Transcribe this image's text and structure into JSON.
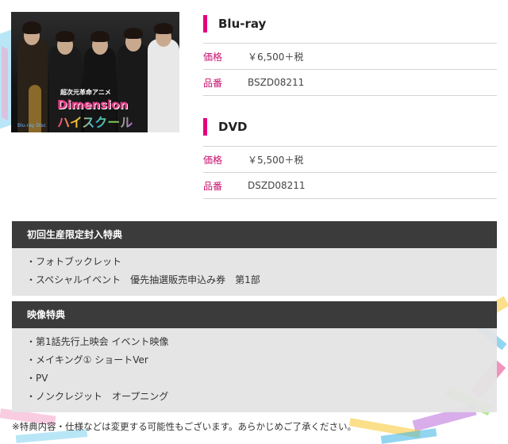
{
  "product_image": {
    "subtitle": "超次元革命アニメ",
    "title_line1": "Dimension",
    "title_line2": "ハイスクール",
    "format_logo": "Blu-ray Disc"
  },
  "formats": [
    {
      "title": "Blu-ray",
      "rows": [
        {
          "label": "価格",
          "value": "￥6,500＋税"
        },
        {
          "label": "品番",
          "value": "BSZD08211"
        }
      ]
    },
    {
      "title": "DVD",
      "rows": [
        {
          "label": "価格",
          "value": "￥5,500＋税"
        },
        {
          "label": "品番",
          "value": "DSZD08211"
        }
      ]
    }
  ],
  "first_press_bonus": {
    "heading": "初回生産限定封入特典",
    "items": [
      "・フォトブックレット",
      "・スペシャルイベント　優先抽選販売申込み券　第1部"
    ]
  },
  "video_bonus": {
    "heading": "映像特典",
    "items": [
      "・第1話先行上映会 イベント映像",
      "・メイキング① ショートVer",
      "・PV",
      "・ノンクレジット　オープニング"
    ]
  },
  "note": "※特典内容・仕様などは変更する可能性もございます。あらかじめご了承ください。",
  "colors": {
    "accent": "#e6007e",
    "label": "#c8106f",
    "panel_header": "#3b3b3b",
    "panel_body": "#e4e4e4"
  }
}
